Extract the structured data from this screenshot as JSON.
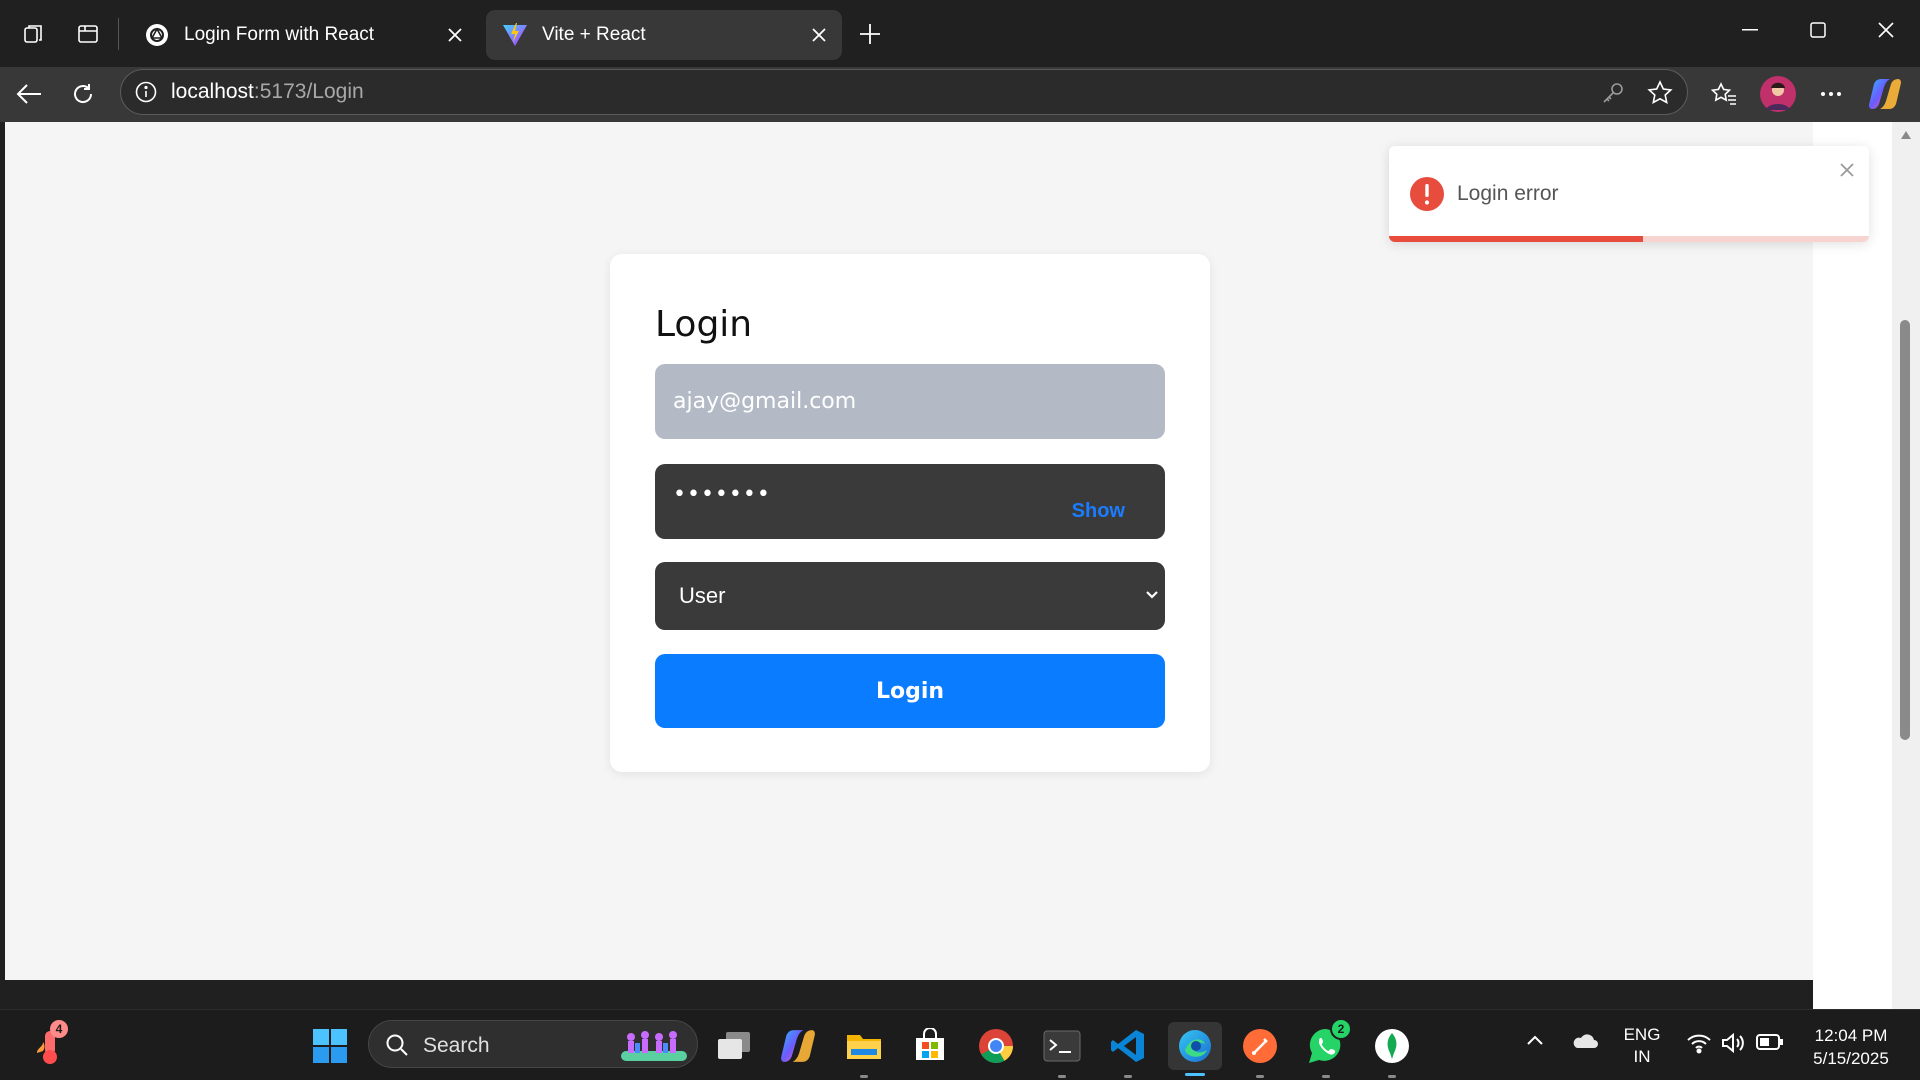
{
  "browser": {
    "tabs": [
      {
        "title": "Login Form with React",
        "active": false
      },
      {
        "title": "Vite + React",
        "active": true
      }
    ],
    "url_host": "localhost",
    "url_path": ":5173/Login"
  },
  "login_form": {
    "title": "Login",
    "email_value": "ajay@gmail.com",
    "password_value": "•••••••",
    "show_label": "Show",
    "role_value": "User",
    "submit_label": "Login"
  },
  "toast": {
    "message": "Login error",
    "progress": 0.53,
    "color": "#e74c3c"
  },
  "taskbar": {
    "search_label": "Search",
    "weather_badge": "4",
    "whatsapp_badge": "2",
    "lang_line1": "ENG",
    "lang_line2": "IN",
    "time": "12:04 PM",
    "date": "5/15/2025"
  },
  "colors": {
    "accent": "#0a7cff",
    "link": "#1a7cff",
    "error": "#e74c3c"
  }
}
